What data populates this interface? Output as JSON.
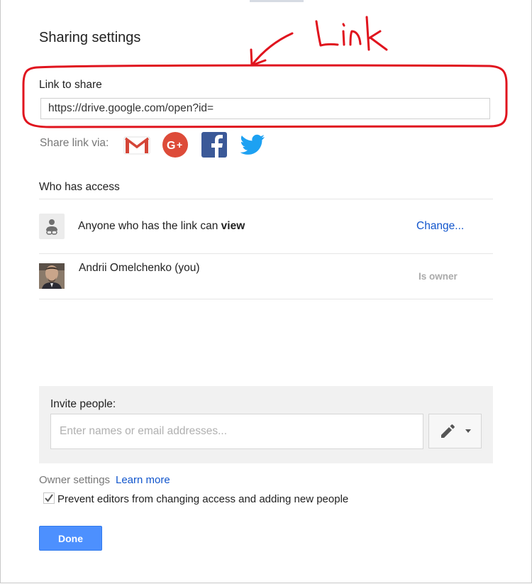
{
  "dialog": {
    "title": "Sharing settings"
  },
  "link_section": {
    "label": "Link to share",
    "url_value": "https://drive.google.com/open?id="
  },
  "share_via": {
    "label": "Share link via:",
    "services": [
      "gmail-icon",
      "google-plus-icon",
      "facebook-icon",
      "twitter-icon"
    ]
  },
  "access": {
    "heading": "Who has access",
    "link_row": {
      "text_prefix": "Anyone who has the link can ",
      "permission": "view",
      "change_label": "Change..."
    },
    "owner_row": {
      "name": "Andrii Omelchenko (you)",
      "role": "Is owner"
    }
  },
  "invite": {
    "label": "Invite people:",
    "placeholder": "Enter names or email addresses..."
  },
  "owner_settings": {
    "label": "Owner settings",
    "learn_more": "Learn more",
    "prevent_label": "Prevent editors from changing access and adding new people",
    "prevent_checked": true
  },
  "actions": {
    "done_label": "Done"
  },
  "annotation": {
    "text": "Link",
    "color": "#e0141e"
  },
  "colors": {
    "accent_blue": "#4d90fe",
    "link_blue": "#1155cc",
    "gmail_red": "#d44638",
    "gplus_red": "#dd4b39",
    "facebook_blue": "#3b5998",
    "twitter_blue": "#1da1f2"
  }
}
